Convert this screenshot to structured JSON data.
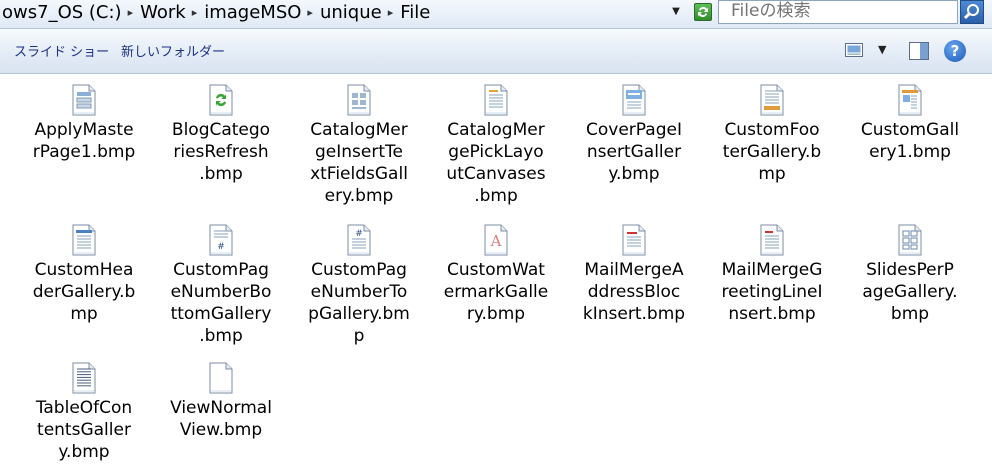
{
  "address_bar": {
    "crumbs": [
      "ows7_OS (C:)",
      "Work",
      "imageMSO",
      "unique",
      "File"
    ],
    "search_placeholder": "Fileの検索"
  },
  "toolbar": {
    "slideshow_label": "スライド ショー",
    "new_folder_label": "新しいフォルダー"
  },
  "icons": {
    "refresh": "refresh-icon",
    "search": "search-icon",
    "view": "view-options-icon",
    "preview": "preview-pane-icon",
    "help": "help-icon",
    "help_glyph": "?"
  },
  "files": [
    {
      "name": "ApplyMasterPage1.bmp",
      "label_lines": [
        "ApplyMaste",
        "rPage1.bmp"
      ],
      "icon": "layout-page-icon"
    },
    {
      "name": "BlogCategoriesRefresh.bmp",
      "label_lines": [
        "BlogCatego",
        "riesRefresh",
        ".bmp"
      ],
      "icon": "refresh-page-icon"
    },
    {
      "name": "CatalogMergeInsertTextFieldsGallery.bmp",
      "label_lines": [
        "CatalogMer",
        "geInsertTe",
        "xtFieldsGall",
        "ery.bmp"
      ],
      "icon": "catalog-fields-icon"
    },
    {
      "name": "CatalogMergePickLayoutCanvases.bmp",
      "label_lines": [
        "CatalogMer",
        "gePickLayo",
        "utCanvases",
        ".bmp"
      ],
      "icon": "catalog-layout-icon"
    },
    {
      "name": "CoverPageInsertGallery.bmp",
      "label_lines": [
        "CoverPageI",
        "nsertGaller",
        "y.bmp"
      ],
      "icon": "cover-page-icon"
    },
    {
      "name": "CustomFooterGallery.bmp",
      "label_lines": [
        "CustomFoo",
        "terGallery.b",
        "mp"
      ],
      "icon": "footer-page-icon"
    },
    {
      "name": "CustomGallery1.bmp",
      "label_lines": [
        "CustomGall",
        "ery1.bmp"
      ],
      "icon": "custom-gallery-icon"
    },
    {
      "name": "CustomHeaderGallery.bmp",
      "label_lines": [
        "CustomHea",
        "derGallery.b",
        "mp"
      ],
      "icon": "header-page-icon"
    },
    {
      "name": "CustomPageNumberBottomGallery.bmp",
      "label_lines": [
        "CustomPag",
        "eNumberBo",
        "ttomGallery",
        ".bmp"
      ],
      "icon": "page-number-bottom-icon"
    },
    {
      "name": "CustomPageNumberTopGallery.bmp",
      "label_lines": [
        "CustomPag",
        "eNumberTo",
        "pGallery.bm",
        "p"
      ],
      "icon": "page-number-top-icon"
    },
    {
      "name": "CustomWatermarkGallery.bmp",
      "label_lines": [
        "CustomWat",
        "ermarkGalle",
        "ry.bmp"
      ],
      "icon": "watermark-page-icon"
    },
    {
      "name": "MailMergeAddressBlockInsert.bmp",
      "label_lines": [
        "MailMergeA",
        "ddressBloc",
        "kInsert.bmp"
      ],
      "icon": "address-block-icon"
    },
    {
      "name": "MailMergeGreetingLineInsert.bmp",
      "label_lines": [
        "MailMergeG",
        "reetingLineI",
        "nsert.bmp"
      ],
      "icon": "greeting-line-icon"
    },
    {
      "name": "SlidesPerPageGallery.bmp",
      "label_lines": [
        "SlidesPerP",
        "ageGallery.",
        "bmp"
      ],
      "icon": "slides-per-page-icon"
    },
    {
      "name": "TableOfContentsGallery.bmp",
      "label_lines": [
        "TableOfCon",
        "tentsGaller",
        "y.bmp"
      ],
      "icon": "table-of-contents-icon"
    },
    {
      "name": "ViewNormalView.bmp",
      "label_lines": [
        "ViewNormal",
        "View.bmp"
      ],
      "icon": "blank-page-icon"
    }
  ]
}
